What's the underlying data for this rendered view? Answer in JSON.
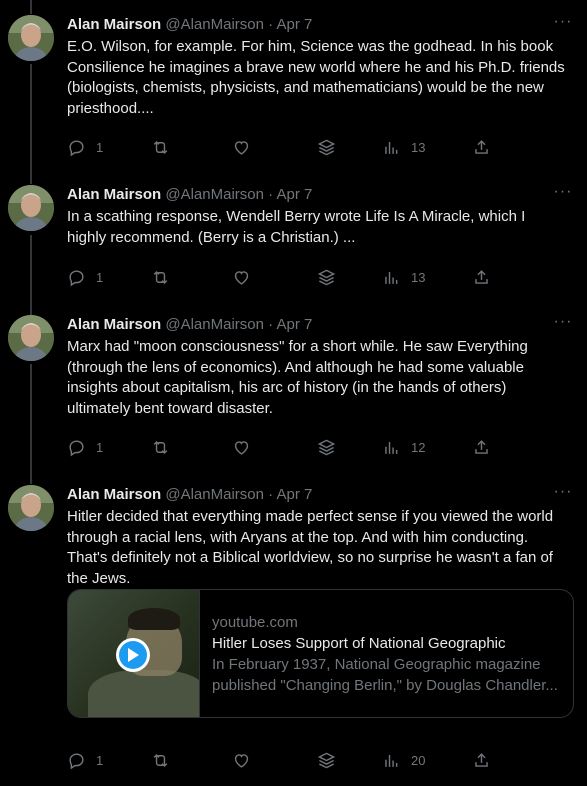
{
  "author": {
    "name": "Alan Mairson",
    "handle": "@AlanMairson",
    "separator": "·"
  },
  "tweets": [
    {
      "date": "Apr 7",
      "text": "E.O. Wilson, for example. For him, Science was the godhead. In his book\nConsilience he imagines a brave new world where he and his Ph.D. friends\n(biologists, chemists, physicists, and mathematicians) would be the new\npriesthood....",
      "replies": "1",
      "retweets": "",
      "likes": "",
      "views": "13"
    },
    {
      "date": "Apr 7",
      "text": "In a scathing response, Wendell Berry wrote Life Is A Miracle, which I\nhighly recommend. (Berry is a Christian.) ...",
      "replies": "1",
      "retweets": "",
      "likes": "",
      "views": "13"
    },
    {
      "date": "Apr 7",
      "text": "Marx had \"moon consciousness\" for a short while. He saw Everything\n(through the lens of economics). And although he had some valuable\ninsights about capitalism, his arc of history (in the hands of others)\nultimately bent toward disaster.",
      "replies": "1",
      "retweets": "",
      "likes": "",
      "views": "12"
    },
    {
      "date": "Apr 7",
      "text": "Hitler decided that everything made perfect sense if you viewed the world\nthrough a racial lens, with Aryans at the top. And with him conducting.\nThat's definitely not a Biblical worldview, so no surprise he wasn't a fan of\nthe Jews.",
      "replies": "1",
      "retweets": "",
      "likes": "",
      "views": "20",
      "card": {
        "domain": "youtube.com",
        "title": "Hitler Loses Support of National Geographic",
        "description_line1": "In February 1937, National Geographic magazine",
        "description_line2": "published \"Changing Berlin,\" by Douglas Chandler..."
      }
    }
  ],
  "icons": {
    "more": "more-horizontal-icon",
    "reply": "reply-icon",
    "retweet": "retweet-icon",
    "like": "heart-icon",
    "bookmark": "stack-icon",
    "views": "views-bar-chart-icon",
    "share": "share-icon",
    "play": "play-icon"
  },
  "colors": {
    "background": "#000000",
    "text": "#e7e9ea",
    "secondary": "#71767b",
    "border": "#2f3336",
    "accent": "#1d9bf0"
  }
}
